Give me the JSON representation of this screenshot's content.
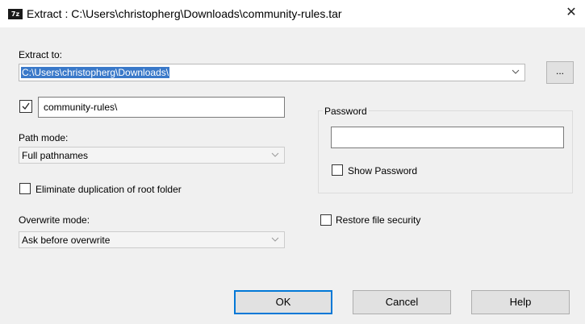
{
  "window": {
    "title": "Extract : C:\\Users\\christopherg\\Downloads\\community-rules.tar",
    "icon_label": "7z"
  },
  "extract_to": {
    "label": "Extract to:",
    "value": "C:\\Users\\christopherg\\Downloads\\",
    "browse_label": "..."
  },
  "subfolder": {
    "checked": true,
    "value": "community-rules\\"
  },
  "path_mode": {
    "label": "Path mode:",
    "value": "Full pathnames"
  },
  "eliminate_duplication": {
    "label": "Eliminate duplication of root folder",
    "checked": false
  },
  "overwrite_mode": {
    "label": "Overwrite mode:",
    "value": "Ask before overwrite"
  },
  "password": {
    "label": "Password",
    "value": "",
    "show_label": "Show Password",
    "show_checked": false
  },
  "restore_security": {
    "label": "Restore file security",
    "checked": false
  },
  "buttons": {
    "ok": "OK",
    "cancel": "Cancel",
    "help": "Help"
  }
}
